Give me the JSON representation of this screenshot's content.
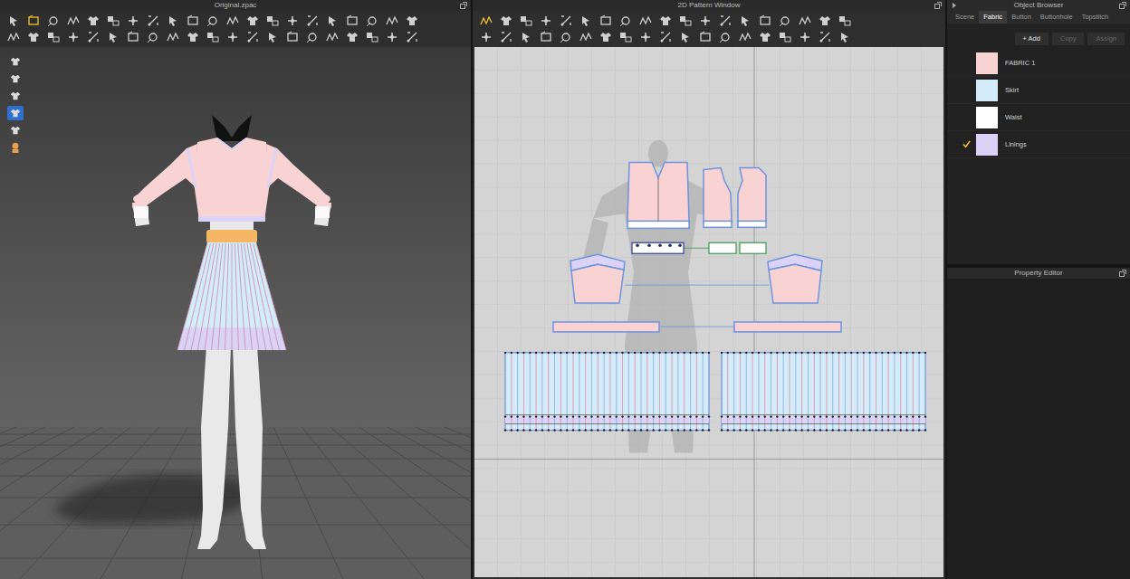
{
  "view_3d": {
    "title": "Original.zpac",
    "toolbar": [
      [
        {
          "selected": false
        },
        {
          "selected": true
        },
        {
          "selected": false
        },
        {
          "selected": false
        },
        {
          "selected": false
        },
        {
          "selected": false
        },
        {
          "selected": false
        },
        {
          "selected": false
        },
        {
          "selected": false
        },
        {
          "selected": false
        },
        {
          "selected": false
        },
        {
          "selected": false
        },
        {
          "selected": false
        },
        {
          "selected": false
        },
        {
          "selected": false
        },
        {
          "selected": false
        },
        {
          "selected": false
        },
        {
          "selected": false
        },
        {
          "selected": false
        },
        {
          "selected": false
        },
        {
          "selected": false
        }
      ],
      [
        {
          "selected": false
        },
        {
          "selected": false
        },
        {
          "selected": false
        },
        {
          "selected": false
        },
        {
          "selected": false
        },
        {
          "selected": false
        },
        {
          "selected": false
        },
        {
          "selected": false
        },
        {
          "selected": false
        },
        {
          "selected": false
        },
        {
          "selected": false
        },
        {
          "selected": false
        },
        {
          "selected": false
        },
        {
          "selected": false
        },
        {
          "selected": false
        },
        {
          "selected": false
        },
        {
          "selected": false
        },
        {
          "selected": false
        },
        {
          "selected": false
        },
        {
          "selected": false
        },
        {
          "selected": false
        }
      ]
    ],
    "avatar_tools": [
      {
        "selected": false
      },
      {
        "selected": false
      },
      {
        "selected": false
      },
      {
        "selected": true
      },
      {
        "selected": false
      },
      {
        "selected": false
      }
    ]
  },
  "pattern_2d": {
    "title": "2D Pattern Window",
    "toolbar": [
      [
        {
          "selected": true
        },
        {
          "selected": false
        },
        {
          "selected": false
        },
        {
          "selected": false
        },
        {
          "selected": false
        },
        {
          "selected": false
        },
        {
          "selected": false
        },
        {
          "selected": false
        },
        {
          "selected": false
        },
        {
          "selected": false
        },
        {
          "selected": false
        },
        {
          "selected": false
        },
        {
          "selected": false
        },
        {
          "selected": false
        },
        {
          "selected": false
        },
        {
          "selected": false
        },
        {
          "selected": false
        },
        {
          "selected": false
        },
        {
          "selected": false
        }
      ],
      [
        {
          "selected": false
        },
        {
          "selected": false
        },
        {
          "selected": false
        },
        {
          "selected": false
        },
        {
          "selected": false
        },
        {
          "selected": false
        },
        {
          "selected": false
        },
        {
          "selected": false
        },
        {
          "selected": false
        },
        {
          "selected": false
        },
        {
          "selected": false
        },
        {
          "selected": false
        },
        {
          "selected": false
        },
        {
          "selected": false
        },
        {
          "selected": false
        },
        {
          "selected": false
        },
        {
          "selected": false
        },
        {
          "selected": false
        },
        {
          "selected": false
        }
      ]
    ]
  },
  "object_browser": {
    "title": "Object Browser",
    "tabs": [
      {
        "label": "Scene",
        "selected": false
      },
      {
        "label": "Fabric",
        "selected": true
      },
      {
        "label": "Button",
        "selected": false
      },
      {
        "label": "Buttonhole",
        "selected": false
      },
      {
        "label": "Topstitch",
        "selected": false
      }
    ],
    "actions": [
      {
        "label": "+ Add",
        "disabled": false
      },
      {
        "label": "Copy",
        "disabled": true
      },
      {
        "label": "Assign",
        "disabled": true
      }
    ],
    "fabrics": [
      {
        "name": "FABRIC 1",
        "color": "#f9d2d4",
        "checked": false
      },
      {
        "name": "Skirt",
        "color": "#d4ecf9",
        "checked": false
      },
      {
        "name": "Waist",
        "color": "#ffffff",
        "checked": false
      },
      {
        "name": "Linings",
        "color": "#dad3f5",
        "checked": true
      }
    ]
  },
  "property_editor": {
    "title": "Property Editor"
  }
}
